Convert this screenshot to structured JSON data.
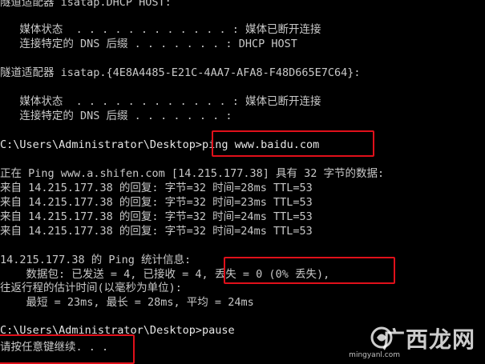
{
  "console": {
    "lines": [
      "隧道适配器 isatap.DHCP HOST:",
      "",
      "   媒体状态  . . . . . . . . . . . . : 媒体已断开连接",
      "   连接特定的 DNS 后缀 . . . . . . . : DHCP HOST",
      "",
      "隧道适配器 isatap.{4E8A4485-E21C-4AA7-AFA8-F48D665E7C64}:",
      "",
      "   媒体状态  . . . . . . . . . . . . : 媒体已断开连接",
      "   连接特定的 DNS 后缀 . . . . . . . :",
      "",
      "C:\\Users\\Administrator\\Desktop>ping www.baidu.com",
      "",
      "正在 Ping www.a.shifen.com [14.215.177.38] 具有 32 字节的数据:",
      "来自 14.215.177.38 的回复: 字节=32 时间=28ms TTL=53",
      "来自 14.215.177.38 的回复: 字节=32 时间=23ms TTL=53",
      "来自 14.215.177.38 的回复: 字节=32 时间=24ms TTL=53",
      "来自 14.215.177.38 的回复: 字节=32 时间=24ms TTL=53",
      "",
      "14.215.177.38 的 Ping 统计信息:",
      "    数据包: 已发送 = 4, 已接收 = 4, 丢失 = 0 (0% 丢失),",
      "往返行程的估计时间(以毫秒为单位):",
      "    最短 = 23ms, 最长 = 28ms, 平均 = 24ms",
      "",
      "C:\\Users\\Administrator\\Desktop>pause",
      "请按任意键继续. . ."
    ]
  },
  "watermark": {
    "brand": "广西龙网",
    "domain": "mingyanl.com"
  },
  "colors": {
    "background": "#000000",
    "text": "#c8c8c8",
    "highlight": "#e0101a"
  }
}
